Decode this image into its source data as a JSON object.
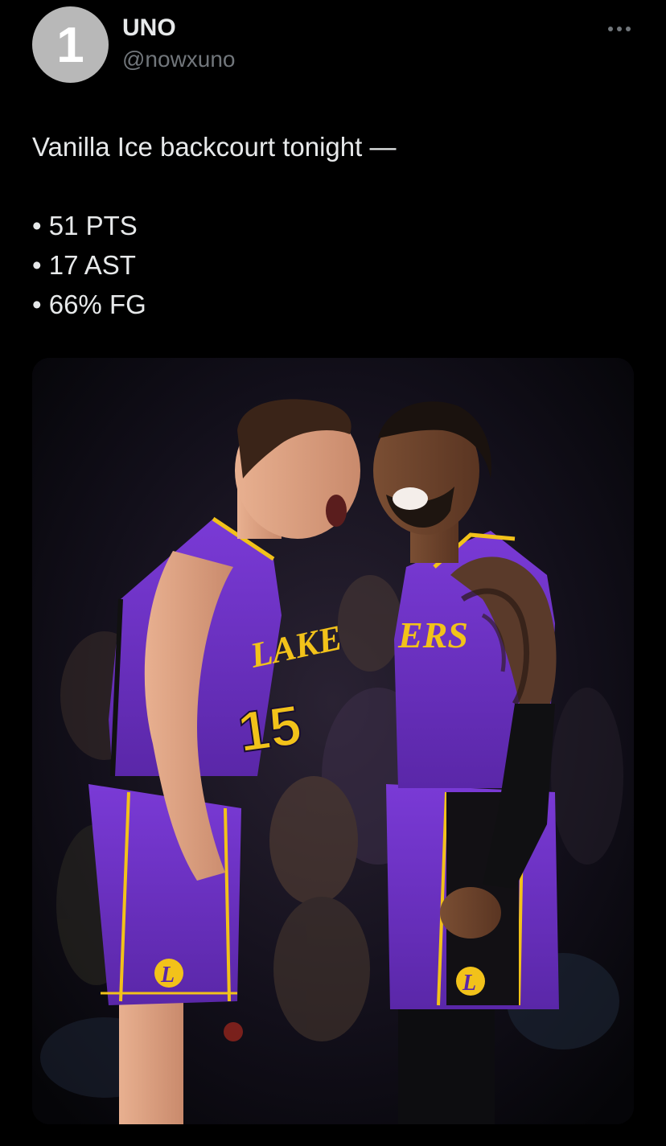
{
  "author": {
    "avatar_text": "1",
    "display_name": "UNO",
    "handle": "@nowxuno"
  },
  "tweet": {
    "headline": "Vanilla Ice backcourt tonight —",
    "stats": [
      "• 51 PTS",
      "• 17 AST",
      "• 66% FG"
    ]
  },
  "media": {
    "jersey_wordmark_left": "LAKE",
    "jersey_number_left": "15",
    "jersey_wordmark_right": "ERS",
    "logo_text": "L"
  },
  "colors": {
    "background": "#000000",
    "primary_text": "#e7e9ea",
    "secondary_text": "#71767b",
    "avatar_bg": "#b8b8b8",
    "lakers_purple": "#6a2fc4",
    "lakers_gold": "#f2c21a"
  },
  "icons": {
    "more": "more-horizontal-icon"
  }
}
